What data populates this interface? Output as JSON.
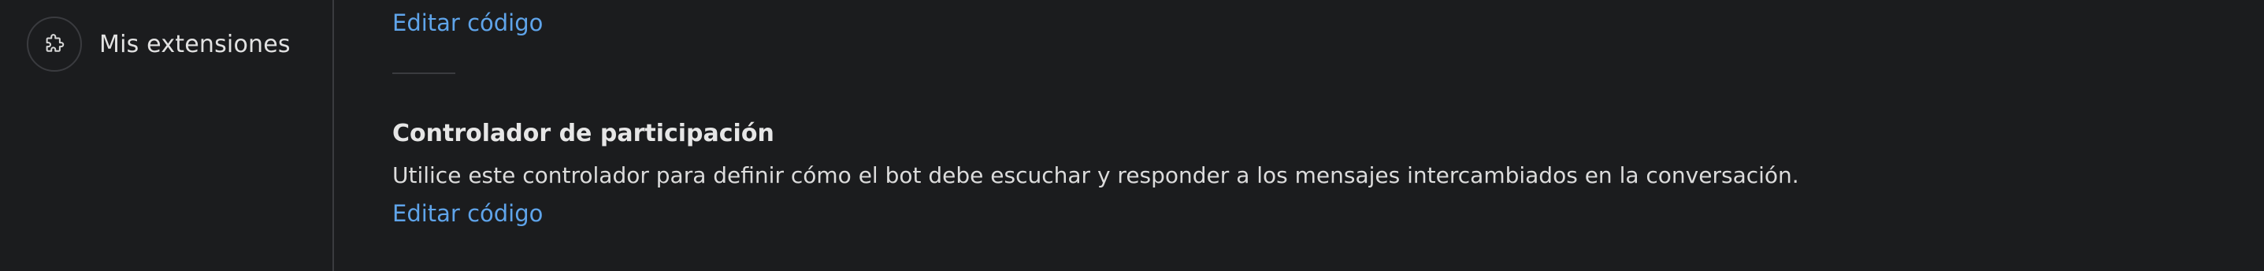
{
  "sidebar": {
    "items": [
      {
        "label": "Mis extensiones",
        "icon": "puzzle-piece-icon"
      }
    ]
  },
  "main": {
    "prev_section": {
      "link_label": "Editar código"
    },
    "section": {
      "title": "Controlador de participación",
      "description": "Utilice este controlador para definir cómo el bot debe escuchar y responder a los mensajes intercambiados en la conversación.",
      "link_label": "Editar código"
    }
  },
  "colors": {
    "background": "#1b1c1e",
    "link": "#5fa4ea",
    "divider": "#3a3b3f"
  }
}
